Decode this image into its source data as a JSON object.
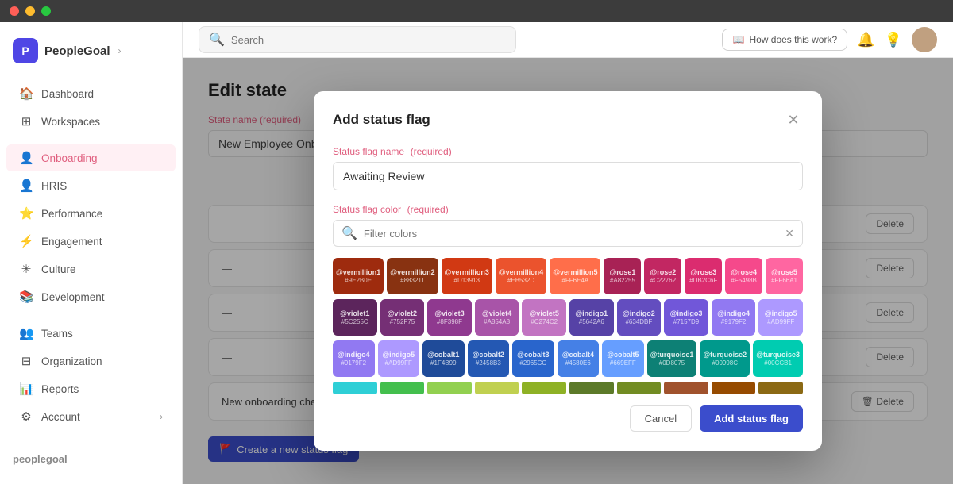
{
  "window": {
    "title": "PeopleGoal"
  },
  "topbar": {
    "search_placeholder": "Search",
    "how_does_label": "How does this work?"
  },
  "sidebar": {
    "brand": "PeopleGoal",
    "items": [
      {
        "id": "dashboard",
        "label": "Dashboard",
        "icon": "🏠"
      },
      {
        "id": "workspaces",
        "label": "Workspaces",
        "icon": "⊞"
      },
      {
        "id": "onboarding",
        "label": "Onboarding",
        "icon": "👤",
        "active": true
      },
      {
        "id": "hris",
        "label": "HRIS",
        "icon": "👤"
      },
      {
        "id": "performance",
        "label": "Performance",
        "icon": "⭐"
      },
      {
        "id": "engagement",
        "label": "Engagement",
        "icon": "⚡"
      },
      {
        "id": "culture",
        "label": "Culture",
        "icon": "✳"
      },
      {
        "id": "development",
        "label": "Development",
        "icon": "📚"
      },
      {
        "id": "teams",
        "label": "Teams",
        "icon": "👥"
      },
      {
        "id": "organization",
        "label": "Organization",
        "icon": "⊟"
      },
      {
        "id": "reports",
        "label": "Reports",
        "icon": "📊"
      },
      {
        "id": "account",
        "label": "Account",
        "icon": "⚙"
      }
    ],
    "footer": "peoplegoal"
  },
  "main": {
    "page_title": "Edit state",
    "state_label": "State name",
    "state_required": "(required)",
    "state_value": "New Employee Onboarding"
  },
  "modal": {
    "title": "Add status flag",
    "name_label": "Status flag name",
    "name_required": "(required)",
    "name_value": "Awaiting Review",
    "color_label": "Status flag color",
    "color_required": "(required)",
    "filter_placeholder": "Filter colors",
    "cancel_label": "Cancel",
    "submit_label": "Add status flag",
    "colors": [
      {
        "name": "@vermillion1",
        "hex": "#9E2B0E",
        "bg": "#9E2B0E"
      },
      {
        "name": "@vermillion2",
        "hex": "#883211",
        "bg": "#883211"
      },
      {
        "name": "@vermillion3",
        "hex": "#D13913",
        "bg": "#D13913"
      },
      {
        "name": "@vermillion4",
        "hex": "#EB532D",
        "bg": "#EB532D"
      },
      {
        "name": "@vermillion5",
        "hex": "#FF6E4A",
        "bg": "#FF6E4A"
      },
      {
        "name": "@rose1",
        "hex": "#A82255",
        "bg": "#A82255"
      },
      {
        "name": "@rose2",
        "hex": "#C22762",
        "bg": "#C22762"
      },
      {
        "name": "@rose3",
        "hex": "#DB2C6F",
        "bg": "#DB2C6F"
      },
      {
        "name": "@rose4",
        "hex": "#F5498B",
        "bg": "#F5498B"
      },
      {
        "name": "@rose5",
        "hex": "#FF66A1",
        "bg": "#FF66A1"
      },
      {
        "name": "@violet1",
        "hex": "#5C255C",
        "bg": "#5C255C"
      },
      {
        "name": "@violet2",
        "hex": "#752F75",
        "bg": "#752F75"
      },
      {
        "name": "@violet3",
        "hex": "#8F398F",
        "bg": "#8F398F"
      },
      {
        "name": "@violet4",
        "hex": "#A854A8",
        "bg": "#A854A8"
      },
      {
        "name": "@violet5",
        "hex": "#C274C2",
        "bg": "#C274C2"
      },
      {
        "name": "@indigo1",
        "hex": "#5642A6",
        "bg": "#5642A6"
      },
      {
        "name": "@indigo2",
        "hex": "#634DBF",
        "bg": "#634DBF"
      },
      {
        "name": "@indigo3",
        "hex": "#7157D9",
        "bg": "#7157D9"
      },
      {
        "name": "@indigo4",
        "hex": "#9179F2",
        "bg": "#9179F2"
      },
      {
        "name": "@indigo5",
        "hex": "#AD99FF",
        "bg": "#AD99FF"
      },
      {
        "name": "@cobalt1",
        "hex": "#1F4B99",
        "bg": "#1F4B99"
      },
      {
        "name": "@cobalt2",
        "hex": "#2458B3",
        "bg": "#2458B3"
      },
      {
        "name": "@cobalt3",
        "hex": "#2965CC",
        "bg": "#2965CC"
      },
      {
        "name": "@cobalt4",
        "hex": "#4580E6",
        "bg": "#4580E6"
      },
      {
        "name": "@cobalt5",
        "hex": "#669EFF",
        "bg": "#669EFF"
      },
      {
        "name": "@turquoise1",
        "hex": "#0D8075",
        "bg": "#0D8075"
      },
      {
        "name": "@turquoise2",
        "hex": "#00998C",
        "bg": "#00998C"
      },
      {
        "name": "",
        "hex": "",
        "bg": ""
      },
      {
        "name": "",
        "hex": "",
        "bg": ""
      },
      {
        "name": "",
        "hex": "",
        "bg": ""
      }
    ],
    "strip_colors": [
      "#2ee6d6",
      "#43BF4D",
      "#92D050",
      "#C0D050",
      "#8EB125",
      "#5C7A29",
      "#728C23",
      "#A0522D",
      "#964B00",
      "#8B6914"
    ]
  },
  "bg_content": {
    "checklist_label": "New onboarding checklist",
    "checklist_color": "#F2B824",
    "delete_label": "Delete",
    "create_flag_label": "Create a new status flag"
  }
}
